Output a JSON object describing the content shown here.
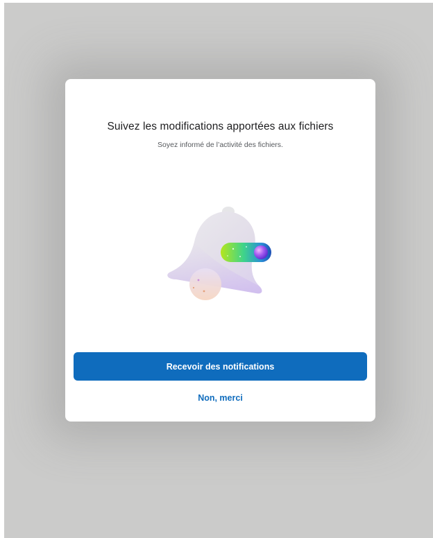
{
  "dialog": {
    "title": "Suivez les modifications apportées aux fichiers",
    "subtitle": "Soyez informé de l’activité des fichiers.",
    "illustration_icon": "bell-with-toggle-icon",
    "primary_button_label": "Recevoir des notifications",
    "secondary_link_label": "Non, merci"
  },
  "colors": {
    "backdrop": "#cbcbca",
    "dialog_background": "#ffffff",
    "accent": "#0f6cbd",
    "title_text": "#1d1d1f",
    "subtitle_text": "#55585c"
  }
}
